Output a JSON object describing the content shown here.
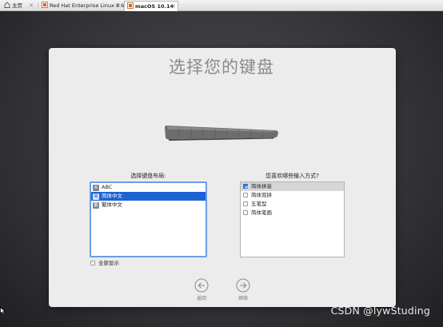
{
  "host_tabs": [
    {
      "label": "主页",
      "active": false
    },
    {
      "label": "Red Hat Enterprise Linux 8 64...",
      "active": false
    },
    {
      "label": "macOS 10.14",
      "active": true
    }
  ],
  "page": {
    "title": "选择您的键盘"
  },
  "layout_section": {
    "label": "选择键盘布局:",
    "items": [
      {
        "label": "ABC",
        "icon": "A",
        "selected": false
      },
      {
        "label": "简体中文",
        "icon": "简",
        "selected": true
      },
      {
        "label": "繁体中文",
        "icon": "繁",
        "selected": false
      }
    ],
    "show_all_label": "全部显示",
    "show_all_checked": false
  },
  "input_section": {
    "label": "您喜欢哪些输入方式?",
    "items": [
      {
        "label": "简体拼音",
        "checked": true
      },
      {
        "label": "简体双拼",
        "checked": false
      },
      {
        "label": "五笔型",
        "checked": false
      },
      {
        "label": "简体笔画",
        "checked": false
      }
    ]
  },
  "nav": {
    "back_label": "返回",
    "continue_label": "继续"
  },
  "watermark": "CSDN @lywStuding",
  "colors": {
    "selection": "#1c63d3",
    "focus_ring": "#6a9ee8",
    "panel": "#ececec"
  }
}
